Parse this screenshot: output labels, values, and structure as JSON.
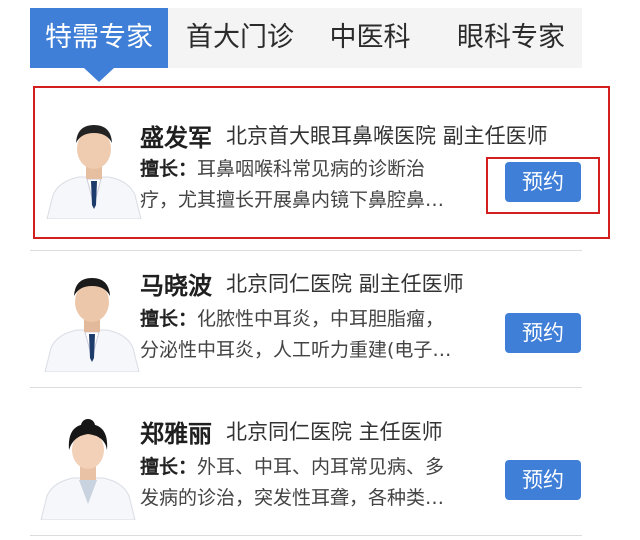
{
  "tabs": [
    {
      "label": "特需专家",
      "active": true
    },
    {
      "label": "首大门诊",
      "active": false
    },
    {
      "label": "中医科",
      "active": false
    },
    {
      "label": "眼科专家",
      "active": false
    }
  ],
  "doctors": [
    {
      "name": "盛发军",
      "hospital_title": "北京首大眼耳鼻喉医院  副主任医师",
      "specialty_label": "擅长：",
      "specialty_line1": "耳鼻咽喉科常见病的诊断治",
      "specialty_line2": "疗，尤其擅长开展鼻内镜下鼻腔鼻…",
      "button": "预约",
      "highlighted": true
    },
    {
      "name": "马晓波",
      "hospital_title": "北京同仁医院  副主任医师",
      "specialty_label": "擅长：",
      "specialty_line1": "化脓性中耳炎，中耳胆脂瘤，",
      "specialty_line2": "分泌性中耳炎，人工听力重建(电子…",
      "button": "预约",
      "highlighted": false
    },
    {
      "name": "郑雅丽",
      "hospital_title": "北京同仁医院  主任医师",
      "specialty_label": "擅长：",
      "specialty_line1": "外耳、中耳、内耳常见病、多",
      "specialty_line2": "发病的诊治，突发性耳聋，各种类…",
      "button": "预约",
      "highlighted": false
    }
  ],
  "colors": {
    "accent": "#3f7fd7",
    "highlight": "#d21f1f",
    "tabbar_bg": "#f4f4f4"
  }
}
